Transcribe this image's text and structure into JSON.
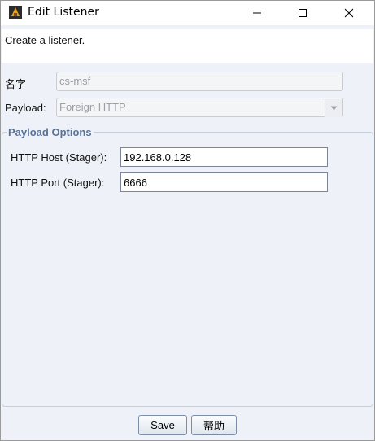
{
  "window": {
    "title": "Edit Listener"
  },
  "description": "Create a listener.",
  "form": {
    "name_label": "名字",
    "name_value": "cs-msf",
    "payload_label": "Payload:",
    "payload_value": "Foreign HTTP"
  },
  "payload_options": {
    "title": "Payload Options",
    "host_label": "HTTP Host (Stager):",
    "host_value": "192.168.0.128",
    "port_label": "HTTP Port (Stager):",
    "port_value": "6666"
  },
  "buttons": {
    "save": "Save",
    "help": "帮助"
  },
  "icons": {
    "app": "java-app-icon",
    "minimize": "minimize-icon",
    "maximize": "maximize-icon",
    "close": "close-icon",
    "dropdown": "chevron-down-icon"
  },
  "colors": {
    "accent": "#5a7397",
    "panel_bg": "#eef2f8"
  }
}
